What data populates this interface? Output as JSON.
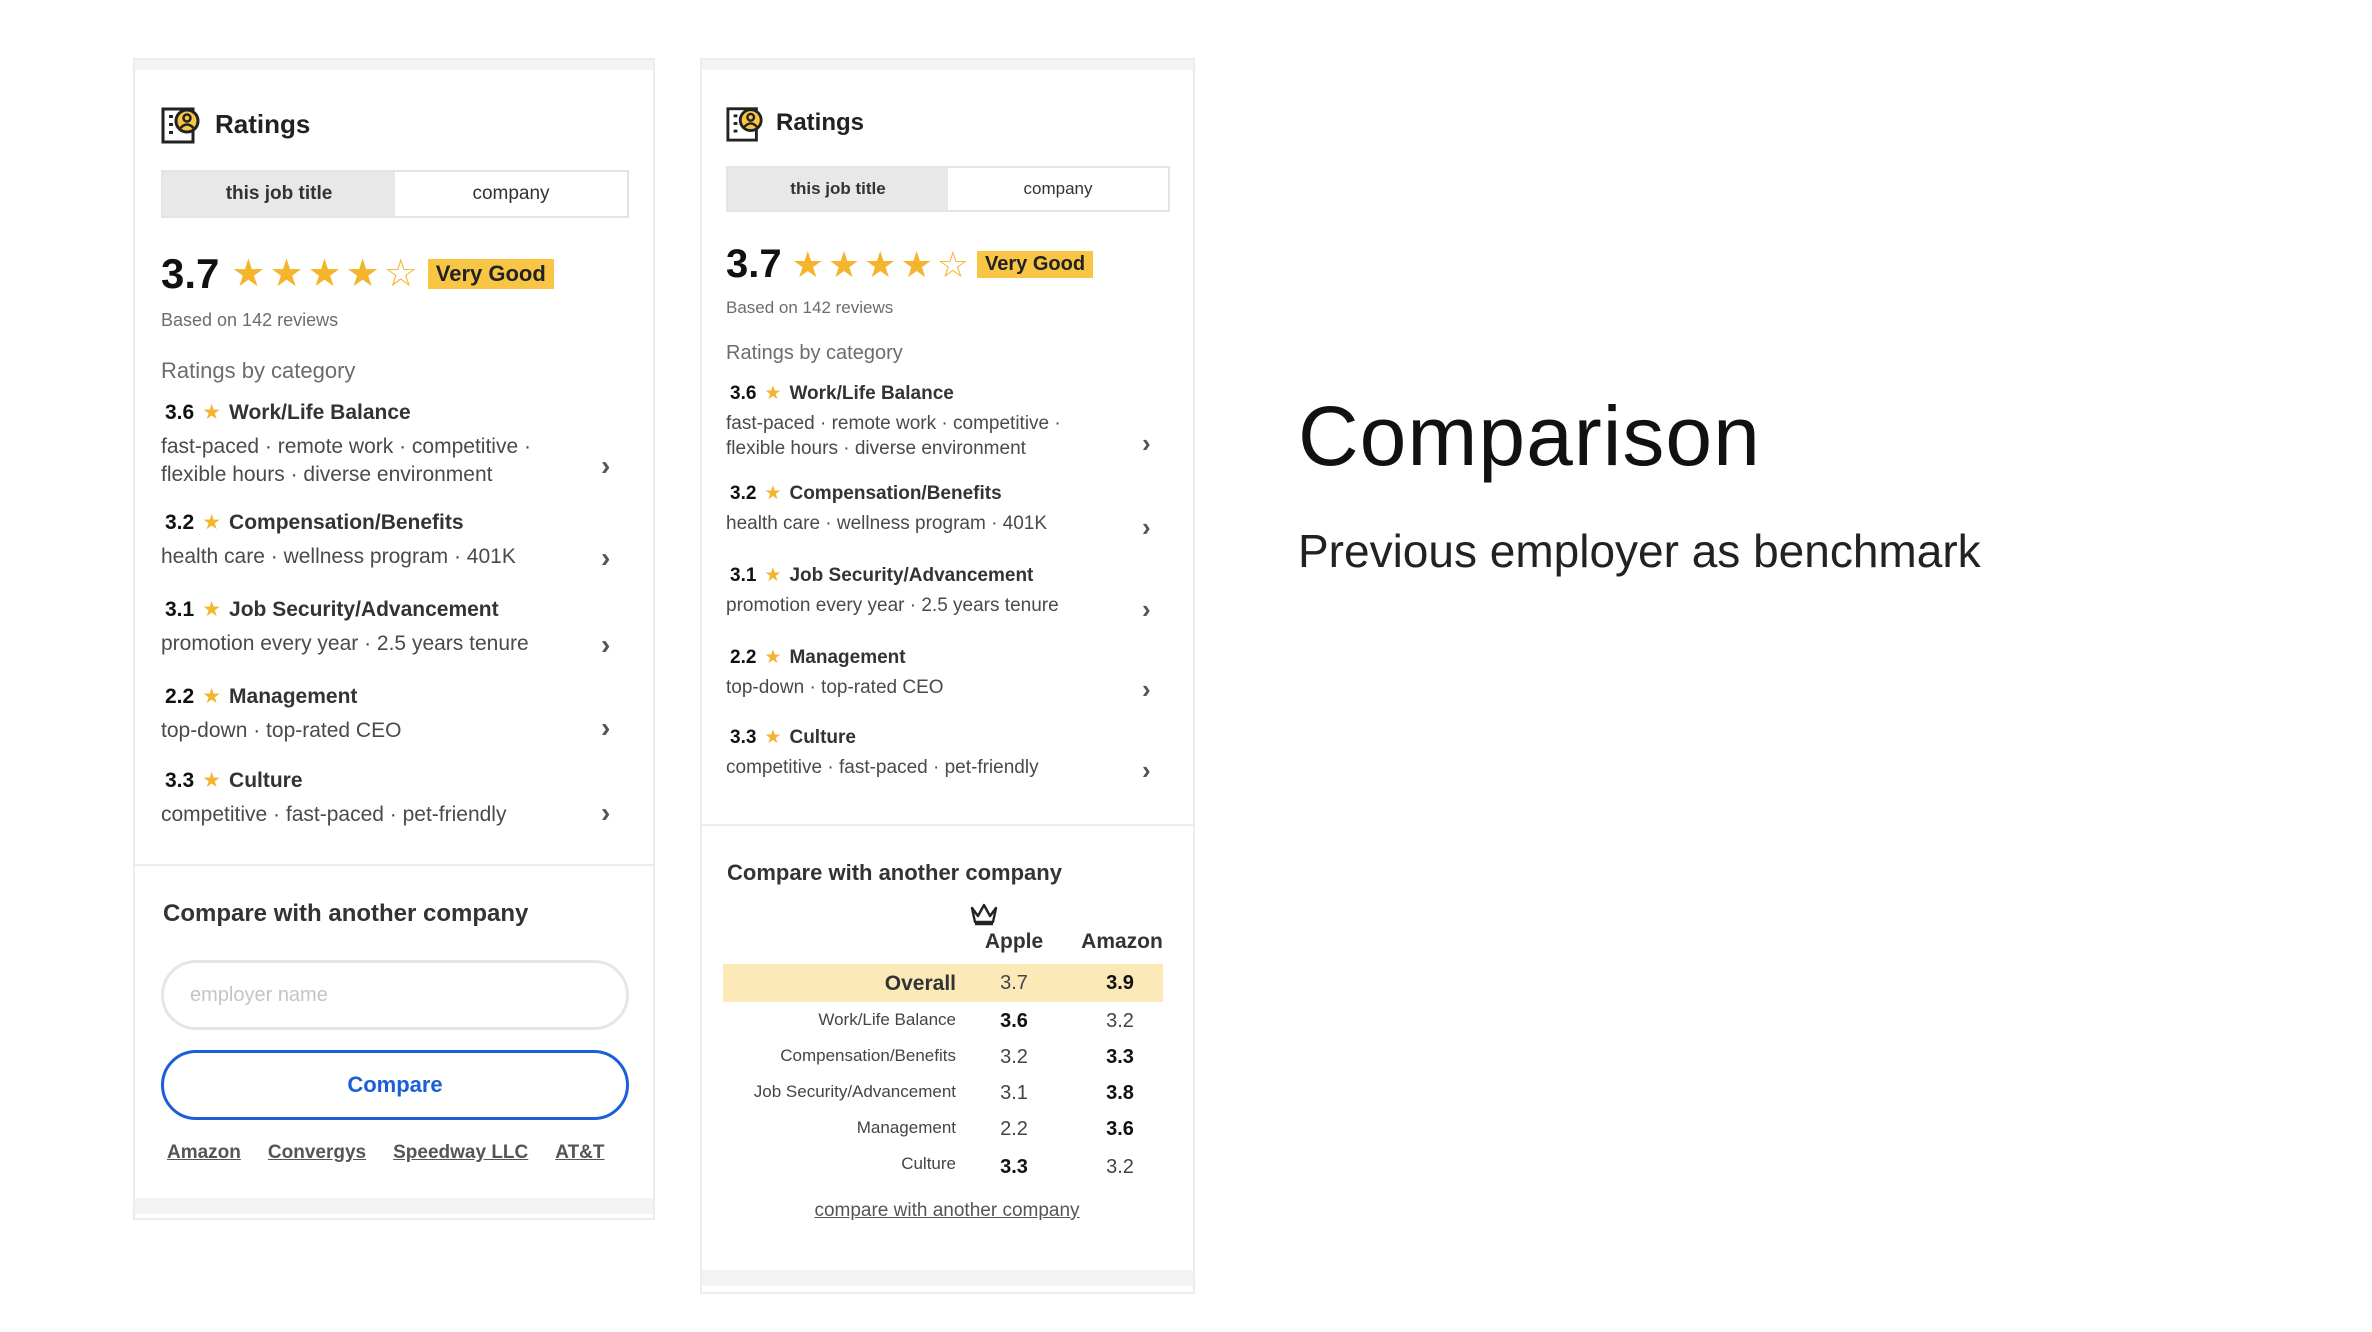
{
  "slide": {
    "title": "Comparison",
    "subtitle": "Previous employer as benchmark"
  },
  "colors": {
    "star": "#f4b42b",
    "badge": "#f8c644",
    "compare_button": "#1a5fd8",
    "overall_highlight": "#fbe9b8"
  },
  "panel_left": {
    "header_title": "Ratings",
    "tabs": [
      "this job title",
      "company"
    ],
    "active_tab": "this job title",
    "score": "3.7",
    "stars_filled": 4,
    "stars_total": 5,
    "badge": "Very Good",
    "reviews": "Based on 142 reviews",
    "section_label": "Ratings by category",
    "categories": [
      {
        "score": "3.6",
        "name": "Work/Life Balance",
        "tags_line1": "fast-paced · remote work · competitive ·",
        "tags_line2": "flexible hours · diverse environment"
      },
      {
        "score": "3.2",
        "name": "Compensation/Benefits",
        "tags_line1": "health care · wellness program · 401K",
        "tags_line2": ""
      },
      {
        "score": "3.1",
        "name": "Job Security/Advancement",
        "tags_line1": "promotion every year · 2.5 years tenure",
        "tags_line2": ""
      },
      {
        "score": "2.2",
        "name": "Management",
        "tags_line1": "top-down · top-rated CEO",
        "tags_line2": ""
      },
      {
        "score": "3.3",
        "name": "Culture",
        "tags_line1": "competitive · fast-paced · pet-friendly",
        "tags_line2": ""
      }
    ],
    "compare_title": "Compare with another company",
    "input_placeholder": "employer name",
    "compare_button": "Compare",
    "company_links": [
      "Amazon",
      "Convergys",
      "Speedway LLC",
      "AT&T"
    ]
  },
  "panel_right": {
    "header_title": "Ratings",
    "tabs": [
      "this job title",
      "company"
    ],
    "active_tab": "this job title",
    "score": "3.7",
    "stars_filled": 4,
    "stars_total": 5,
    "badge": "Very Good",
    "reviews": "Based on 142 reviews",
    "section_label": "Ratings by category",
    "categories": [
      {
        "score": "3.6",
        "name": "Work/Life Balance",
        "tags_line1": "fast-paced · remote work · competitive ·",
        "tags_line2": "flexible hours · diverse environment"
      },
      {
        "score": "3.2",
        "name": "Compensation/Benefits",
        "tags_line1": "health care · wellness program · 401K",
        "tags_line2": ""
      },
      {
        "score": "3.1",
        "name": "Job Security/Advancement",
        "tags_line1": "promotion every year · 2.5 years tenure",
        "tags_line2": ""
      },
      {
        "score": "2.2",
        "name": "Management",
        "tags_line1": "top-down · top-rated CEO",
        "tags_line2": ""
      },
      {
        "score": "3.3",
        "name": "Culture",
        "tags_line1": "competitive · fast-paced · pet-friendly",
        "tags_line2": ""
      }
    ],
    "compare_title": "Compare with another company",
    "table": {
      "columns": [
        "Apple",
        "Amazon"
      ],
      "winner_icon": "crown-icon",
      "rows": [
        {
          "label": "Overall",
          "a": "3.7",
          "b": "3.9",
          "winner": "b"
        },
        {
          "label": "Work/Life Balance",
          "a": "3.6",
          "b": "3.2",
          "winner": "a"
        },
        {
          "label": "Compensation/Benefits",
          "a": "3.2",
          "b": "3.3",
          "winner": "b"
        },
        {
          "label": "Job Security/Advancement",
          "a": "3.1",
          "b": "3.8",
          "winner": "b"
        },
        {
          "label": "Management",
          "a": "2.2",
          "b": "3.6",
          "winner": "b"
        },
        {
          "label": "Culture",
          "a": "3.3",
          "b": "3.2",
          "winner": "a"
        }
      ]
    },
    "compare_link": "compare with another company"
  }
}
